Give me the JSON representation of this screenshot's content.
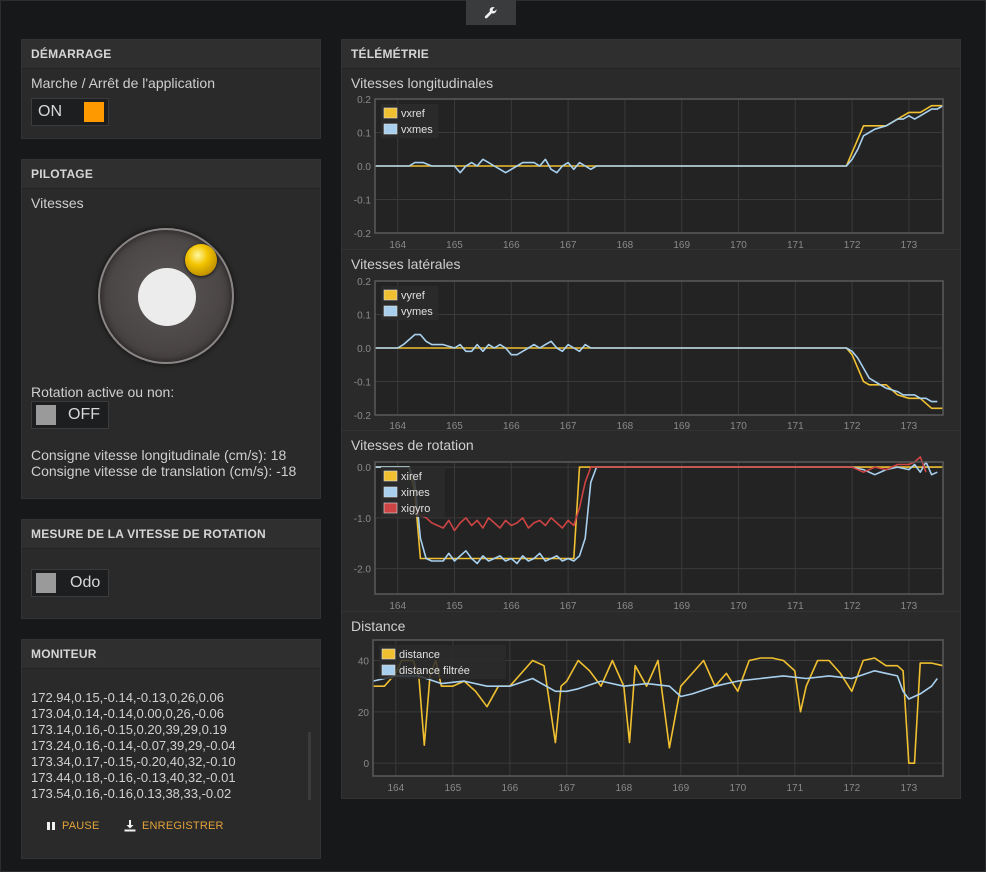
{
  "app": {
    "tool_icon": "wrench-icon"
  },
  "demarrage": {
    "header": "DÉMARRAGE",
    "label": "Marche / Arrêt de l'application",
    "toggle_label": "ON",
    "toggle_color": "#ff9900"
  },
  "pilotage": {
    "header": "PILOTAGE",
    "vitesses_label": "Vitesses",
    "rotation_label": "Rotation active ou non:",
    "rotation_toggle": "OFF",
    "consigne_long": "Consigne vitesse longitudinale (cm/s): 18",
    "consigne_trans": "Consigne vitesse de translation (cm/s): -18"
  },
  "mesure": {
    "header": "MESURE DE LA VITESSE DE ROTATION",
    "toggle_label": "Odo"
  },
  "moniteur": {
    "header": "MONITEUR",
    "lines": [
      "172.94,0.15,-0.14,-0.13,0,26,0.06",
      "173.04,0.14,-0.14,0.00,0,26,-0.06",
      "173.14,0.16,-0.15,0.20,39,29,0.19",
      "173.24,0.16,-0.14,-0.07,39,29,-0.04",
      "173.34,0.17,-0.15,-0.20,40,32,-0.10",
      "173.44,0.18,-0.16,-0.13,40,32,-0.01",
      "173.54,0.16,-0.16,0.13,38,33,-0.02"
    ],
    "pause_label": "PAUSE",
    "record_label": "ENREGISTRER",
    "pause_icon": "pause-icon",
    "record_icon": "download-icon"
  },
  "telemetrie": {
    "header": "TÉLÉMÉTRIE"
  },
  "colors": {
    "ref": "#f0c030",
    "mes": "#a8d0ee",
    "gyro": "#cc4444",
    "grid": "#3a3a3a",
    "axis": "#5a5a5a"
  },
  "chart_data": [
    {
      "type": "line",
      "title": "Vitesses longitudinales",
      "xlim": [
        163.6,
        173.6
      ],
      "ylim": [
        -0.2,
        0.2
      ],
      "yticks": [
        "0.2",
        "0.1",
        "0.0",
        "-0.1",
        "-0.2"
      ],
      "ytick_values": [
        0.2,
        0.1,
        0.0,
        -0.1,
        -0.2
      ],
      "xticks": [
        "164",
        "165",
        "166",
        "167",
        "168",
        "169",
        "170",
        "171",
        "172",
        "173"
      ],
      "series": [
        {
          "name": "vxref",
          "color": "#f0c030",
          "x": [
            163.6,
            164.0,
            164.2,
            164.4,
            164.5,
            165.0,
            165.5,
            166.0,
            166.5,
            167.0,
            167.5,
            168.0,
            171.9,
            172.0,
            172.1,
            172.2,
            172.3,
            172.4,
            172.6,
            172.8,
            173.0,
            173.1,
            173.2,
            173.4,
            173.6
          ],
          "y": [
            0,
            0,
            0,
            0,
            0,
            0,
            0,
            0,
            0,
            0,
            0,
            0,
            0,
            0.04,
            0.08,
            0.12,
            0.12,
            0.12,
            0.12,
            0.14,
            0.16,
            0.16,
            0.16,
            0.18,
            0.18
          ]
        },
        {
          "name": "vxmes",
          "color": "#a8d0ee",
          "x": [
            163.6,
            164.0,
            164.2,
            164.3,
            164.45,
            164.6,
            165.0,
            165.1,
            165.2,
            165.3,
            165.4,
            165.5,
            165.6,
            165.7,
            165.8,
            165.9,
            166.0,
            166.1,
            166.2,
            166.3,
            166.4,
            166.5,
            166.6,
            166.7,
            166.8,
            166.9,
            167.0,
            167.1,
            167.2,
            167.3,
            167.4,
            167.5,
            167.6,
            168.0,
            171.9,
            172.0,
            172.1,
            172.2,
            172.3,
            172.4,
            172.6,
            172.8,
            172.9,
            173.0,
            173.1,
            173.2,
            173.3,
            173.4,
            173.5,
            173.6
          ],
          "y": [
            0,
            0,
            0,
            0.01,
            0.01,
            0,
            0,
            -0.02,
            0,
            0.01,
            0,
            0.02,
            0.01,
            0,
            -0.01,
            -0.02,
            -0.01,
            0,
            0.01,
            0.01,
            0.01,
            0,
            0.02,
            -0.01,
            -0.02,
            0,
            0.01,
            -0.01,
            0.01,
            0,
            -0.01,
            0,
            0,
            0,
            0,
            0.02,
            0.05,
            0.09,
            0.1,
            0.11,
            0.12,
            0.14,
            0.14,
            0.15,
            0.14,
            0.15,
            0.16,
            0.17,
            0.17,
            0.18
          ]
        }
      ]
    },
    {
      "type": "line",
      "title": "Vitesses latérales",
      "xlim": [
        163.6,
        173.6
      ],
      "ylim": [
        -0.2,
        0.2
      ],
      "yticks": [
        "0.2",
        "0.1",
        "0.0",
        "-0.1",
        "-0.2"
      ],
      "ytick_values": [
        0.2,
        0.1,
        0.0,
        -0.1,
        -0.2
      ],
      "xticks": [
        "164",
        "165",
        "166",
        "167",
        "168",
        "169",
        "170",
        "171",
        "172",
        "173"
      ],
      "series": [
        {
          "name": "vyref",
          "color": "#f0c030",
          "x": [
            163.6,
            164.0,
            164.5,
            165.0,
            165.5,
            166.0,
            166.5,
            167.0,
            167.5,
            168.0,
            171.9,
            172.0,
            172.1,
            172.2,
            172.3,
            172.4,
            172.6,
            172.8,
            173.0,
            173.2,
            173.4,
            173.6
          ],
          "y": [
            0,
            0,
            0,
            0,
            0,
            0,
            0,
            0,
            0,
            0,
            0,
            -0.02,
            -0.06,
            -0.1,
            -0.11,
            -0.11,
            -0.11,
            -0.14,
            -0.15,
            -0.15,
            -0.18,
            -0.18
          ]
        },
        {
          "name": "vymes",
          "color": "#a8d0ee",
          "x": [
            163.6,
            164.0,
            164.1,
            164.3,
            164.4,
            164.5,
            164.6,
            164.8,
            165.0,
            165.1,
            165.2,
            165.3,
            165.4,
            165.5,
            165.6,
            165.7,
            165.8,
            165.9,
            166.0,
            166.1,
            166.2,
            166.3,
            166.4,
            166.5,
            166.6,
            166.7,
            166.8,
            166.9,
            167.0,
            167.1,
            167.2,
            167.3,
            167.4,
            167.5,
            168.0,
            171.9,
            172.0,
            172.1,
            172.2,
            172.3,
            172.4,
            172.6,
            172.8,
            172.9,
            173.0,
            173.1,
            173.2,
            173.3,
            173.4,
            173.5
          ],
          "y": [
            0,
            0,
            0.01,
            0.04,
            0.04,
            0.02,
            0.01,
            0.01,
            0,
            0.01,
            -0.01,
            -0.01,
            0.01,
            -0.01,
            0.01,
            0,
            0.01,
            0,
            -0.02,
            -0.02,
            -0.01,
            0,
            0.01,
            0,
            0.01,
            0.02,
            0,
            -0.01,
            0.01,
            0,
            -0.01,
            0.01,
            0,
            0,
            0,
            0,
            -0.01,
            -0.03,
            -0.06,
            -0.09,
            -0.1,
            -0.12,
            -0.13,
            -0.14,
            -0.14,
            -0.14,
            -0.15,
            -0.15,
            -0.16,
            -0.16
          ]
        }
      ]
    },
    {
      "type": "line",
      "title": "Vitesses de rotation",
      "xlim": [
        163.6,
        173.6
      ],
      "ylim": [
        -2.5,
        0.1
      ],
      "yticks": [
        "0.0",
        "-1.0",
        "-2.0"
      ],
      "ytick_values": [
        0.0,
        -1.0,
        -2.0
      ],
      "xticks": [
        "164",
        "165",
        "166",
        "167",
        "168",
        "169",
        "170",
        "171",
        "172",
        "173"
      ],
      "series": [
        {
          "name": "xiref",
          "color": "#f0c030",
          "x": [
            163.6,
            164.0,
            164.1,
            164.2,
            164.3,
            164.4,
            164.5,
            165.0,
            166.0,
            167.0,
            167.1,
            167.2,
            167.3,
            168.0,
            170.0,
            172.0,
            172.2,
            172.4,
            172.8,
            173.0,
            173.2,
            173.4,
            173.6
          ],
          "y": [
            0,
            0,
            0,
            0,
            -0.5,
            -1.8,
            -1.8,
            -1.8,
            -1.8,
            -1.8,
            -1.8,
            0,
            0,
            0,
            0,
            0,
            0,
            0,
            0,
            0,
            0,
            0,
            0
          ]
        },
        {
          "name": "ximes",
          "color": "#a8d0ee",
          "x": [
            163.6,
            164.0,
            164.2,
            164.3,
            164.4,
            164.5,
            164.6,
            164.8,
            164.9,
            165.0,
            165.1,
            165.2,
            165.3,
            165.4,
            165.5,
            165.6,
            165.7,
            165.8,
            165.9,
            166.0,
            166.1,
            166.2,
            166.3,
            166.4,
            166.5,
            166.6,
            166.7,
            166.8,
            166.9,
            167.0,
            167.1,
            167.2,
            167.3,
            167.4,
            167.5,
            168.0,
            169.0,
            170.0,
            171.0,
            172.0,
            172.2,
            172.4,
            172.6,
            172.8,
            173.0,
            173.1,
            173.2,
            173.3,
            173.4,
            173.5
          ],
          "y": [
            0,
            0,
            0,
            -0.3,
            -1.4,
            -1.8,
            -1.85,
            -1.85,
            -1.7,
            -1.85,
            -1.75,
            -1.65,
            -1.8,
            -1.9,
            -1.75,
            -1.85,
            -1.8,
            -1.75,
            -1.85,
            -1.8,
            -1.9,
            -1.75,
            -1.85,
            -1.8,
            -1.7,
            -1.85,
            -1.8,
            -1.75,
            -1.85,
            -1.8,
            -1.85,
            -1.75,
            -1.4,
            -0.3,
            0,
            0,
            0,
            0,
            0,
            0,
            -0.05,
            -0.15,
            -0.05,
            0,
            -0.05,
            0.05,
            -0.1,
            0.1,
            -0.15,
            -0.1
          ]
        },
        {
          "name": "xigyro",
          "color": "#cc4444",
          "x": [
            164.3,
            164.4,
            164.5,
            164.6,
            164.8,
            164.9,
            165.0,
            165.1,
            165.2,
            165.3,
            165.4,
            165.5,
            165.6,
            165.7,
            165.8,
            165.9,
            166.0,
            166.1,
            166.2,
            166.3,
            166.4,
            166.5,
            166.6,
            166.7,
            166.8,
            166.9,
            167.0,
            167.1,
            167.2,
            167.3,
            167.4,
            167.5,
            168.0,
            169.0,
            170.0,
            171.0,
            172.0,
            172.2,
            172.4,
            172.6,
            172.8,
            173.0,
            173.1,
            173.2,
            173.3
          ],
          "y": [
            -0.8,
            -0.95,
            -1.0,
            -1.1,
            -1.2,
            -1.05,
            -1.25,
            -1.1,
            -1.0,
            -1.15,
            -1.05,
            -1.2,
            -1.0,
            -1.1,
            -1.2,
            -1.05,
            -1.15,
            -1.1,
            -1.0,
            -1.2,
            -1.1,
            -1.05,
            -1.15,
            -1.0,
            -1.1,
            -1.2,
            -1.05,
            -1.15,
            -0.8,
            -0.3,
            0,
            0,
            0,
            0,
            0,
            0,
            0,
            -0.1,
            0,
            -0.05,
            0.05,
            0.05,
            0.1,
            0.2,
            -0.1
          ]
        }
      ]
    },
    {
      "type": "line",
      "title": "Distance",
      "xlim": [
        163.6,
        173.6
      ],
      "ylim": [
        -5,
        48
      ],
      "yticks": [
        "40",
        "20",
        "0"
      ],
      "ytick_values": [
        40,
        20,
        0
      ],
      "xticks": [
        "164",
        "165",
        "166",
        "167",
        "168",
        "169",
        "170",
        "171",
        "172",
        "173"
      ],
      "series": [
        {
          "name": "distance",
          "color": "#f0c030",
          "x": [
            163.6,
            163.8,
            164.0,
            164.1,
            164.3,
            164.4,
            164.5,
            164.6,
            164.7,
            164.8,
            165.0,
            165.2,
            165.4,
            165.6,
            165.8,
            166.0,
            166.2,
            166.4,
            166.6,
            166.8,
            166.9,
            167.0,
            167.2,
            167.4,
            167.6,
            167.8,
            168.0,
            168.1,
            168.2,
            168.4,
            168.6,
            168.8,
            169.0,
            169.2,
            169.4,
            169.6,
            169.8,
            170.0,
            170.2,
            170.4,
            170.6,
            170.8,
            171.0,
            171.1,
            171.2,
            171.4,
            171.6,
            171.8,
            172.0,
            172.2,
            172.4,
            172.6,
            172.8,
            172.9,
            173.0,
            173.1,
            173.2,
            173.4,
            173.6
          ],
          "y": [
            30,
            30,
            35,
            40,
            40,
            35,
            7,
            34,
            40,
            30,
            30,
            32,
            28,
            22,
            30,
            30,
            35,
            40,
            38,
            8,
            30,
            32,
            40,
            36,
            30,
            40,
            30,
            8,
            38,
            30,
            40,
            6,
            30,
            35,
            40,
            30,
            35,
            28,
            40,
            41,
            41,
            40,
            36,
            20,
            30,
            40,
            40,
            35,
            28,
            40,
            41,
            38,
            38,
            36,
            0,
            0,
            39,
            39,
            38
          ]
        },
        {
          "name": "distance filtrée",
          "color": "#a8d0ee",
          "x": [
            163.6,
            164.0,
            164.4,
            164.8,
            165.2,
            165.6,
            166.0,
            166.4,
            166.8,
            167.0,
            167.2,
            167.6,
            168.0,
            168.4,
            168.8,
            169.0,
            169.2,
            169.6,
            170.0,
            170.4,
            170.8,
            171.2,
            171.6,
            172.0,
            172.4,
            172.8,
            172.9,
            173.0,
            173.2,
            173.4,
            173.5
          ],
          "y": [
            32,
            34,
            34,
            31,
            32,
            30,
            30,
            33,
            28,
            28,
            29,
            32,
            30,
            31,
            30,
            26,
            27,
            30,
            32,
            33,
            34,
            33,
            34,
            33,
            36,
            34,
            28,
            25,
            27,
            30,
            33
          ]
        }
      ]
    }
  ]
}
